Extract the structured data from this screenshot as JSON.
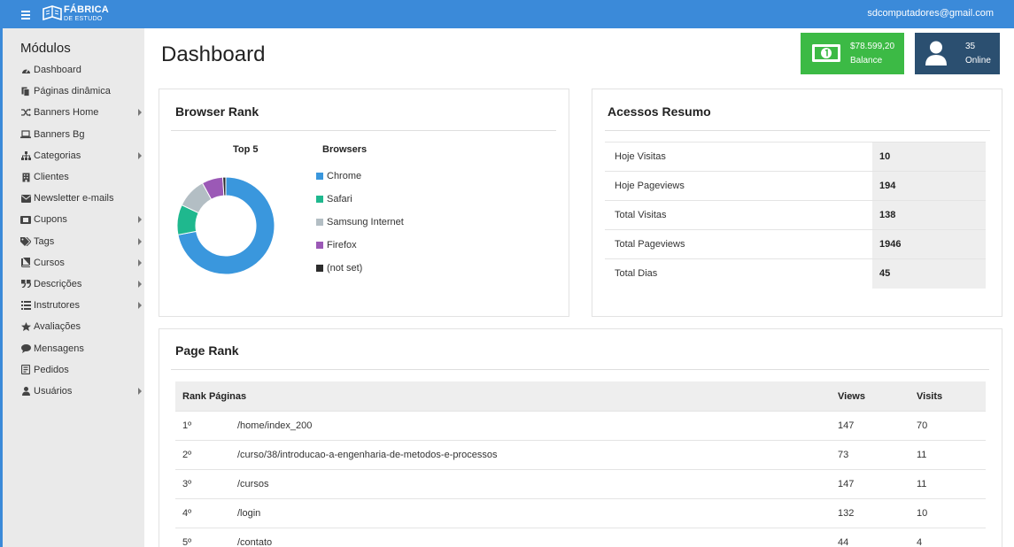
{
  "topbar": {
    "logo_line1": "FÁBRICA",
    "logo_line2": "DE ESTUDO",
    "user_email": "sdcomputadores@gmail.com"
  },
  "sidebar": {
    "title": "Módulos",
    "items": [
      {
        "label": "Dashboard",
        "icon": "dashboard-icon",
        "has_submenu": false
      },
      {
        "label": "Páginas dinâmica",
        "icon": "pages-icon",
        "has_submenu": false
      },
      {
        "label": "Banners Home",
        "icon": "shuffle-icon",
        "has_submenu": true
      },
      {
        "label": "Banners Bg",
        "icon": "laptop-icon",
        "has_submenu": false
      },
      {
        "label": "Categorias",
        "icon": "sitemap-icon",
        "has_submenu": true
      },
      {
        "label": "Clientes",
        "icon": "building-icon",
        "has_submenu": false
      },
      {
        "label": "Newsletter e-mails",
        "icon": "envelope-icon",
        "has_submenu": false
      },
      {
        "label": "Cupons",
        "icon": "ticket-icon",
        "has_submenu": true
      },
      {
        "label": "Tags",
        "icon": "tags-icon",
        "has_submenu": true
      },
      {
        "label": "Cursos",
        "icon": "book-icon",
        "has_submenu": true
      },
      {
        "label": "Descrições",
        "icon": "quote-icon",
        "has_submenu": true
      },
      {
        "label": "Instrutores",
        "icon": "list-icon",
        "has_submenu": true
      },
      {
        "label": "Avaliações",
        "icon": "star-icon",
        "has_submenu": false
      },
      {
        "label": "Mensagens",
        "icon": "comment-icon",
        "has_submenu": false
      },
      {
        "label": "Pedidos",
        "icon": "order-icon",
        "has_submenu": false
      },
      {
        "label": "Usuários",
        "icon": "user-icon",
        "has_submenu": true
      }
    ]
  },
  "page": {
    "title": "Dashboard"
  },
  "stats": {
    "balance": {
      "value": "$78.599,20",
      "label": "Balance",
      "icon": "money-icon",
      "color": "#3cba45"
    },
    "online": {
      "value": "35",
      "label": "Online",
      "icon": "user-icon",
      "color": "#2b4f70"
    }
  },
  "browser_rank": {
    "title": "Browser Rank",
    "chart_title": "Top 5",
    "legend_title": "Browsers"
  },
  "chart_data": {
    "type": "pie",
    "donut": true,
    "title": "Top 5",
    "legend_title": "Browsers",
    "legend_position": "right",
    "categories": [
      "Chrome",
      "Safari",
      "Samsung Internet",
      "Firefox",
      "(not set)"
    ],
    "values": [
      72,
      10,
      10,
      7,
      1
    ],
    "colors": [
      "#3a97dd",
      "#1fb88e",
      "#b3bec4",
      "#9b59b6",
      "#2c2c2c"
    ]
  },
  "acessos": {
    "title": "Acessos Resumo",
    "rows": [
      {
        "label": "Hoje Visitas",
        "value": "10"
      },
      {
        "label": "Hoje Pageviews",
        "value": "194"
      },
      {
        "label": "Total Visitas",
        "value": "138"
      },
      {
        "label": "Total Pageviews",
        "value": "1946"
      },
      {
        "label": "Total Dias",
        "value": "45"
      }
    ]
  },
  "page_rank": {
    "title": "Page Rank",
    "headers": {
      "rank_pages": "Rank Páginas",
      "views": "Views",
      "visits": "Visits"
    },
    "rows": [
      {
        "rank": "1º",
        "page": "/home/index_200",
        "views": "147",
        "visits": "70"
      },
      {
        "rank": "2º",
        "page": "/curso/38/introducao-a-engenharia-de-metodos-e-processos",
        "views": "73",
        "visits": "11"
      },
      {
        "rank": "3º",
        "page": "/cursos",
        "views": "147",
        "visits": "11"
      },
      {
        "rank": "4º",
        "page": "/login",
        "views": "132",
        "visits": "10"
      },
      {
        "rank": "5º",
        "page": "/contato",
        "views": "44",
        "visits": "4"
      }
    ]
  }
}
